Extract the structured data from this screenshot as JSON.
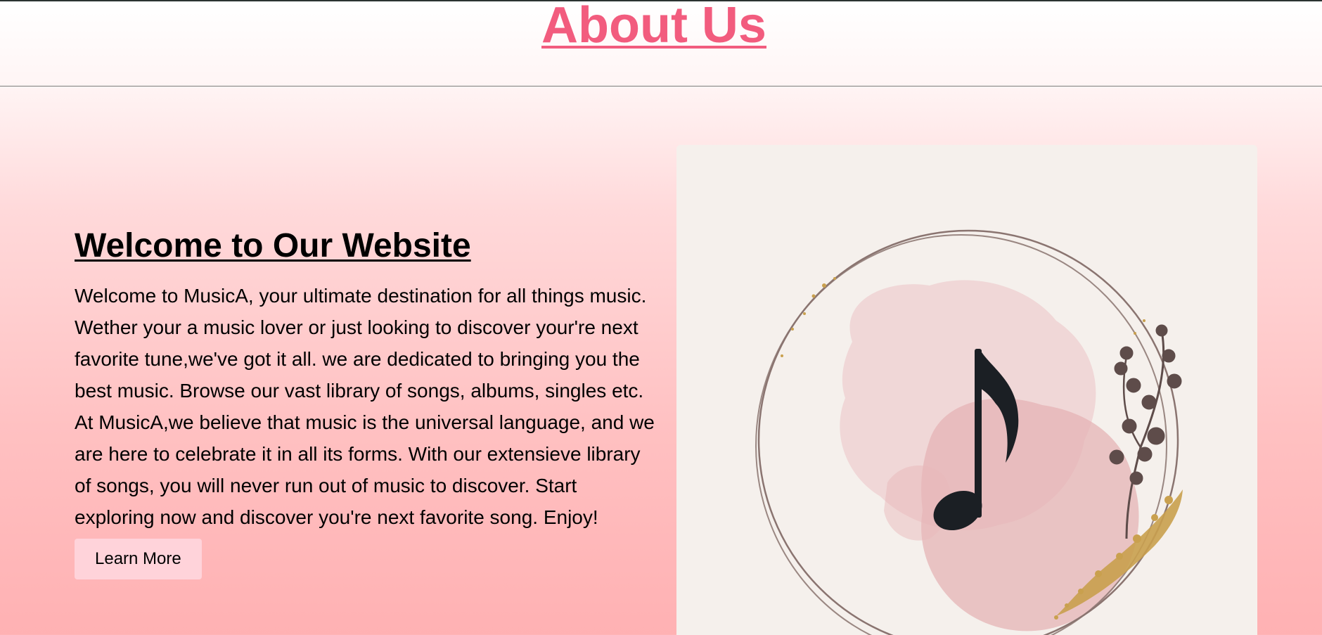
{
  "header": {
    "title": "About Us"
  },
  "main": {
    "heading": "Welcome to Our Website",
    "description": "Welcome to MusicA, your ultimate destination for all things music. Wether your a music lover or just looking to discover your're next favorite tune,we've got it all. we are dedicated to bringing you the best music. Browse our vast library of songs, albums, singles etc. At MusicA,we believe that music is the universal language, and we are here to celebrate it in all its forms. With our extensieve library of songs, you will never run out of music to discover. Start exploring now and discover you're next favorite song. Enjoy!",
    "button_label": "Learn More"
  },
  "image": {
    "icon": "music-note-icon",
    "colors": {
      "card_background": "#f5f0ec",
      "watercolor": "#e7b9bb",
      "note": "#1b1f24",
      "ring": "#8a7470",
      "gold": "#c9a04e"
    }
  },
  "colors": {
    "title": "#f25c7e",
    "button_background": "#ffd3da",
    "text": "#000000"
  }
}
